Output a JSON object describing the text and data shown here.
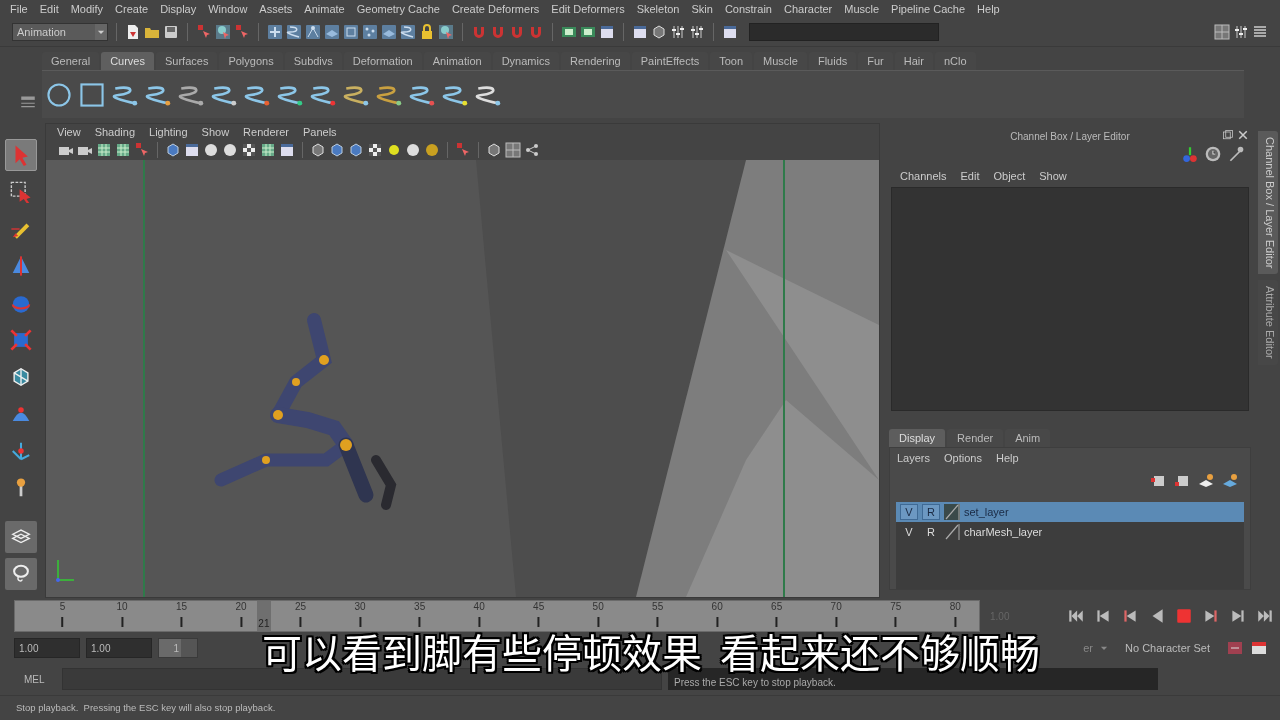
{
  "menu_bar": [
    "File",
    "Edit",
    "Modify",
    "Create",
    "Display",
    "Window",
    "Assets",
    "Animate",
    "Geometry Cache",
    "Create Deformers",
    "Edit Deformers",
    "Skeleton",
    "Skin",
    "Constrain",
    "Character",
    "Muscle",
    "Pipeline Cache",
    "Help"
  ],
  "status_line": {
    "mode": "Animation"
  },
  "shelf": {
    "tabs": [
      {
        "label": "General",
        "selected": false
      },
      {
        "label": "Curves",
        "selected": true
      },
      {
        "label": "Surfaces",
        "selected": false
      },
      {
        "label": "Polygons",
        "selected": false
      },
      {
        "label": "Subdivs",
        "selected": false
      },
      {
        "label": "Deformation",
        "selected": false
      },
      {
        "label": "Animation",
        "selected": false
      },
      {
        "label": "Dynamics",
        "selected": false
      },
      {
        "label": "Rendering",
        "selected": false
      },
      {
        "label": "PaintEffects",
        "selected": false
      },
      {
        "label": "Toon",
        "selected": false
      },
      {
        "label": "Muscle",
        "selected": false
      },
      {
        "label": "Fluids",
        "selected": false
      },
      {
        "label": "Fur",
        "selected": false
      },
      {
        "label": "Hair",
        "selected": false
      },
      {
        "label": "nClo",
        "selected": false
      }
    ]
  },
  "toolbox": {
    "tools": [
      {
        "kind": "select",
        "selected": true
      },
      {
        "kind": "lasso",
        "selected": false
      },
      {
        "kind": "paint",
        "selected": false
      },
      {
        "kind": "move",
        "selected": false
      },
      {
        "kind": "rotate",
        "selected": false
      },
      {
        "kind": "scale",
        "selected": false
      },
      {
        "kind": "universal",
        "selected": false
      },
      {
        "kind": "soft",
        "selected": false
      },
      {
        "kind": "show",
        "selected": false
      },
      {
        "kind": "last",
        "selected": false
      }
    ]
  },
  "viewport": {
    "menus": [
      "View",
      "Shading",
      "Lighting",
      "Show",
      "Renderer",
      "Panels"
    ]
  },
  "channel_box": {
    "title": "Channel Box / Layer Editor",
    "menus": [
      "Channels",
      "Edit",
      "Object",
      "Show"
    ]
  },
  "layer_editor": {
    "tabs": [
      {
        "label": "Display",
        "selected": true
      },
      {
        "label": "Render",
        "selected": false
      },
      {
        "label": "Anim",
        "selected": false
      }
    ],
    "menus": [
      "Layers",
      "Options",
      "Help"
    ],
    "layers": [
      {
        "visible": "V",
        "render": "R",
        "name": "set_layer",
        "selected": true
      },
      {
        "visible": "V",
        "render": "R",
        "name": "charMesh_layer",
        "selected": false
      }
    ]
  },
  "side_tabs": [
    {
      "label": "Channel Box / Layer Editor",
      "selected": true
    },
    {
      "label": "Attribute Editor",
      "selected": false
    }
  ],
  "time_slider": {
    "ticks": [
      "5",
      "10",
      "15",
      "20",
      "25",
      "30",
      "35",
      "40",
      "45",
      "50",
      "55",
      "60",
      "65",
      "70",
      "75",
      "80"
    ],
    "current_frame": "21",
    "level": 0.253,
    "current_time": "1.00"
  },
  "range_bar": {
    "start": "1.00",
    "inner_start": "1.00",
    "slider_value": "1",
    "level": 0,
    "anim_layer": "er",
    "character_set": "No Character Set"
  },
  "command_line": {
    "label": "MEL",
    "result": "Press the ESC key to stop playback."
  },
  "help_line": "Stop playback.  Pressing the ESC key will also stop playback.",
  "subtitle": "可以看到脚有些停顿效果  看起来还不够顺畅"
}
